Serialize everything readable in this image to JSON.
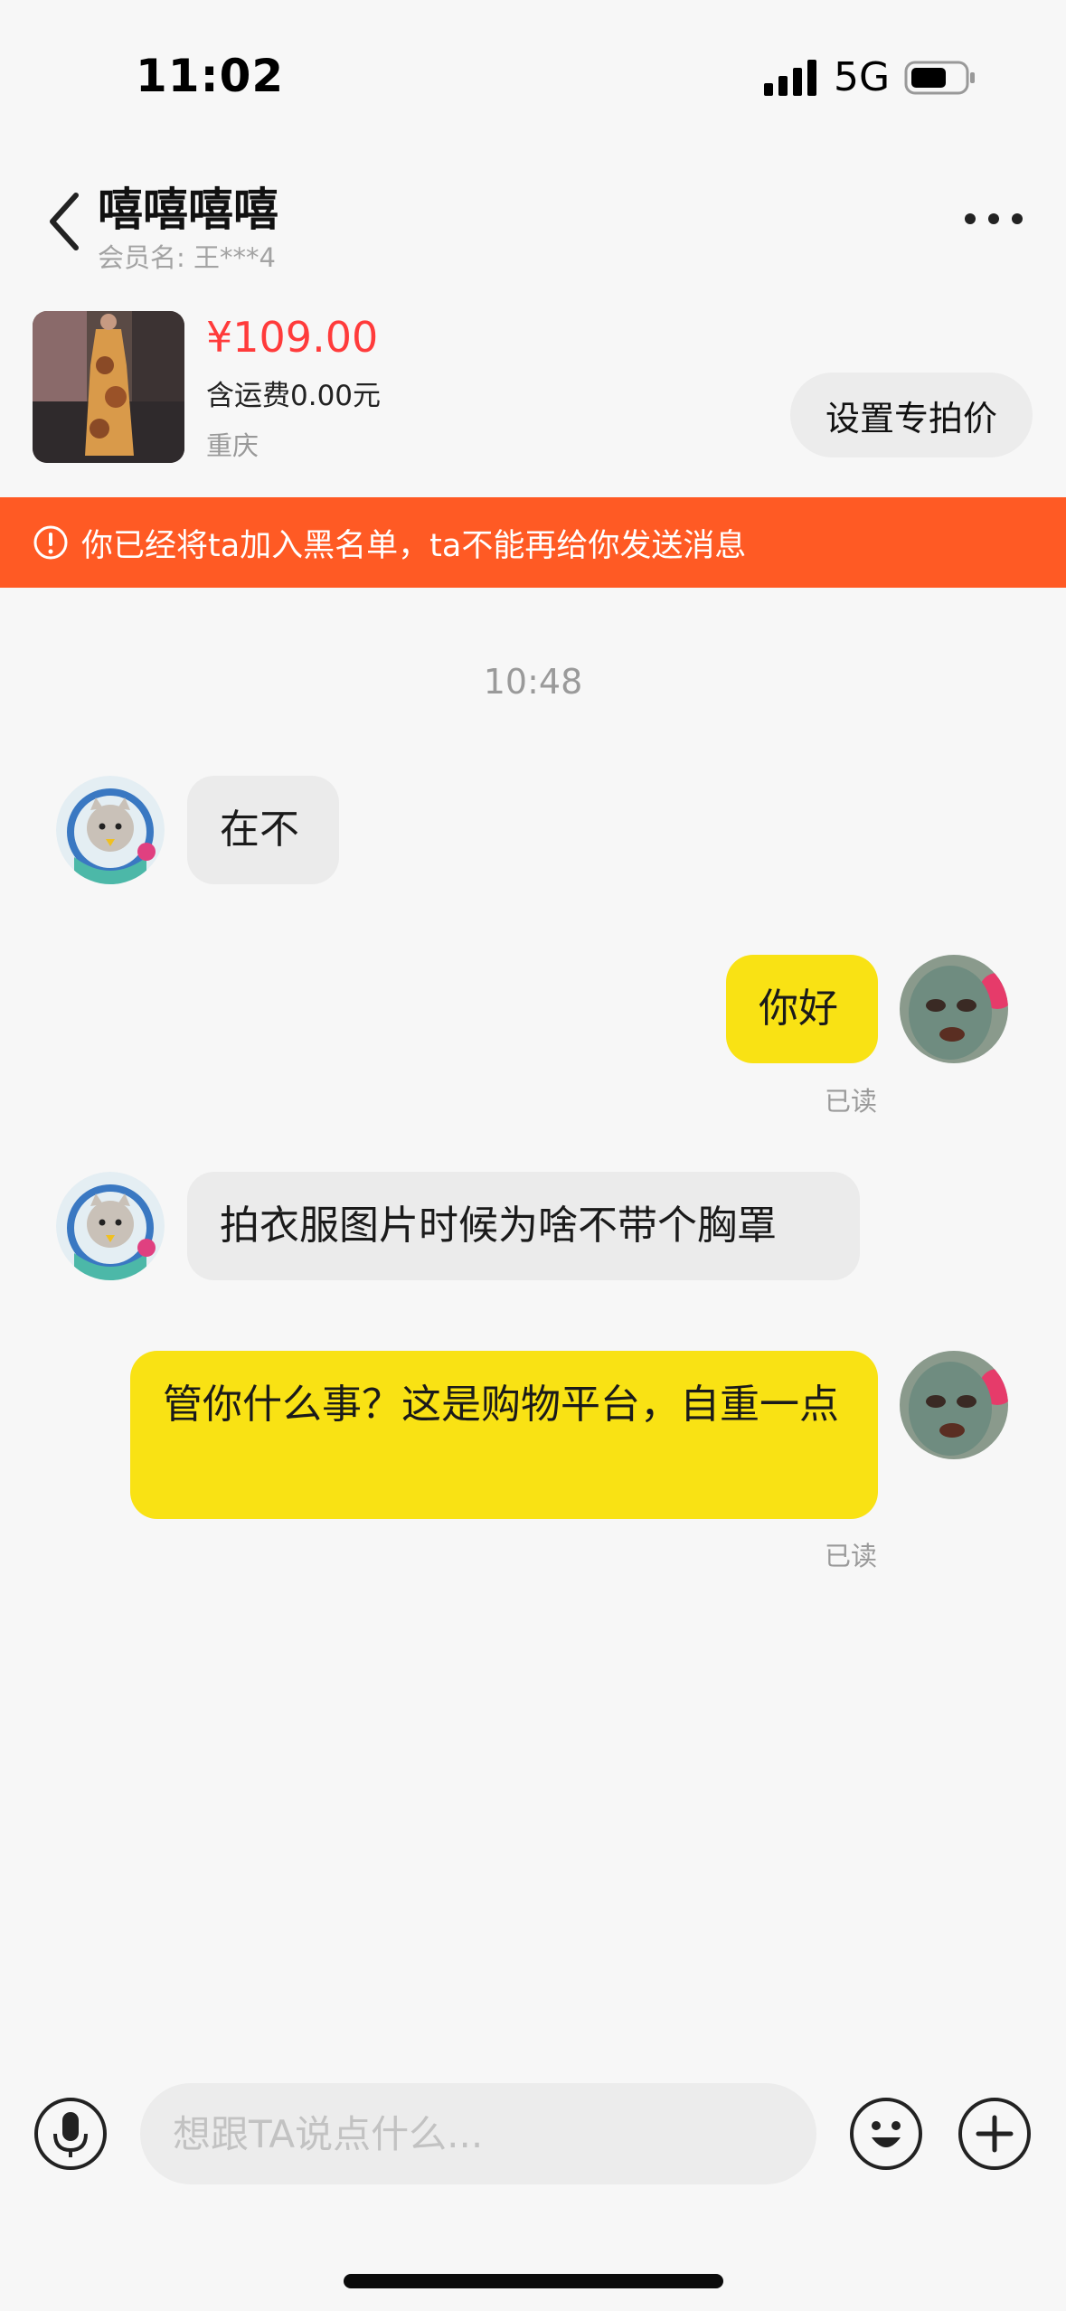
{
  "status_bar": {
    "time": "11:02",
    "network": "5G"
  },
  "header": {
    "contact_name": "嘻嘻嘻嘻",
    "member_label": "会员名:",
    "member_value": "王***4"
  },
  "product": {
    "price": "¥109.00",
    "shipping": "含运费0.00元",
    "location": "重庆",
    "special_price_button": "设置专拍价"
  },
  "banner": {
    "text": "你已经将ta加入黑名单，ta不能再给你发送消息"
  },
  "chat": {
    "timestamp": "10:48",
    "messages": [
      {
        "from": "other",
        "text": "在不"
      },
      {
        "from": "me",
        "text": "你好",
        "status": "已读"
      },
      {
        "from": "other",
        "text": "拍衣服图片时候为啥不带个胸罩"
      },
      {
        "from": "me",
        "text": "管你什么事？这是购物平台，自重一点",
        "status": "已读"
      }
    ]
  },
  "input_bar": {
    "placeholder": "想跟TA说点什么..."
  },
  "colors": {
    "accent_price": "#ff3b3b",
    "banner_bg": "#ff5a24",
    "bubble_me": "#f9e214",
    "bubble_other": "#ebebeb"
  },
  "icons": [
    "back-icon",
    "more-icon",
    "warning-icon",
    "microphone-icon",
    "emoji-icon",
    "plus-icon"
  ]
}
